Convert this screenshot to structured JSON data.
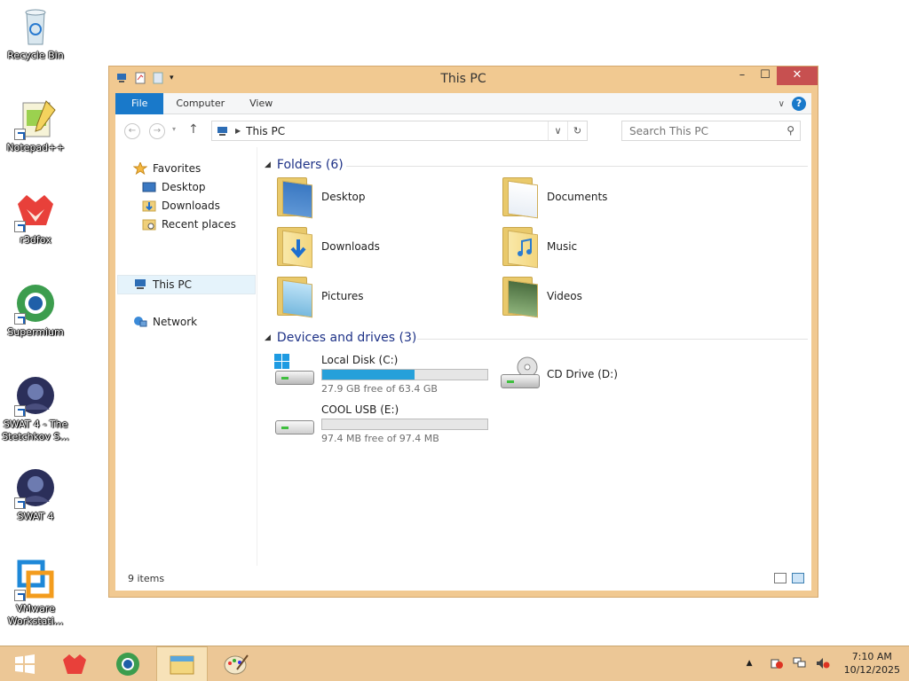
{
  "desktop": {
    "icons": [
      {
        "label": "Recycle Bin"
      },
      {
        "label": "Notepad++"
      },
      {
        "label": "r3dfox"
      },
      {
        "label": "Supermium"
      },
      {
        "label": "SWAT 4 - The Stetchkov S..."
      },
      {
        "label": "SWAT 4"
      },
      {
        "label": "VMware Workstati..."
      }
    ]
  },
  "window": {
    "title": "This PC",
    "caption": {
      "minimize": "–",
      "maximize": "☐",
      "close": "✕"
    },
    "ribbon": {
      "tabs": [
        "File",
        "Computer",
        "View"
      ],
      "help": "?"
    },
    "address": {
      "path": "This PC"
    },
    "search": {
      "placeholder": "Search This PC"
    },
    "nav": {
      "favorites": "Favorites",
      "desktop": "Desktop",
      "downloads": "Downloads",
      "recent": "Recent places",
      "this_pc": "This PC",
      "network": "Network"
    },
    "folders_header": "Folders (6)",
    "folders": [
      "Desktop",
      "Documents",
      "Downloads",
      "Music",
      "Pictures",
      "Videos"
    ],
    "devices_header": "Devices and drives (3)",
    "drives": [
      {
        "name": "Local Disk (C:)",
        "free": "27.9 GB free of 63.4 GB",
        "used_fraction": 0.56
      },
      {
        "name": "CD Drive (D:)"
      },
      {
        "name": "COOL USB (E:)",
        "free": "97.4 MB free of 97.4 MB",
        "used_fraction": 0.0
      }
    ],
    "status": "9 items"
  },
  "taskbar": {
    "clock_time": "7:10 AM",
    "clock_date": "10/12/2025"
  },
  "colors": {
    "accent": "#1979ca",
    "window_frame": "#f1c991",
    "taskbar": "#ecc796",
    "drive_bar": "#26a0da"
  }
}
